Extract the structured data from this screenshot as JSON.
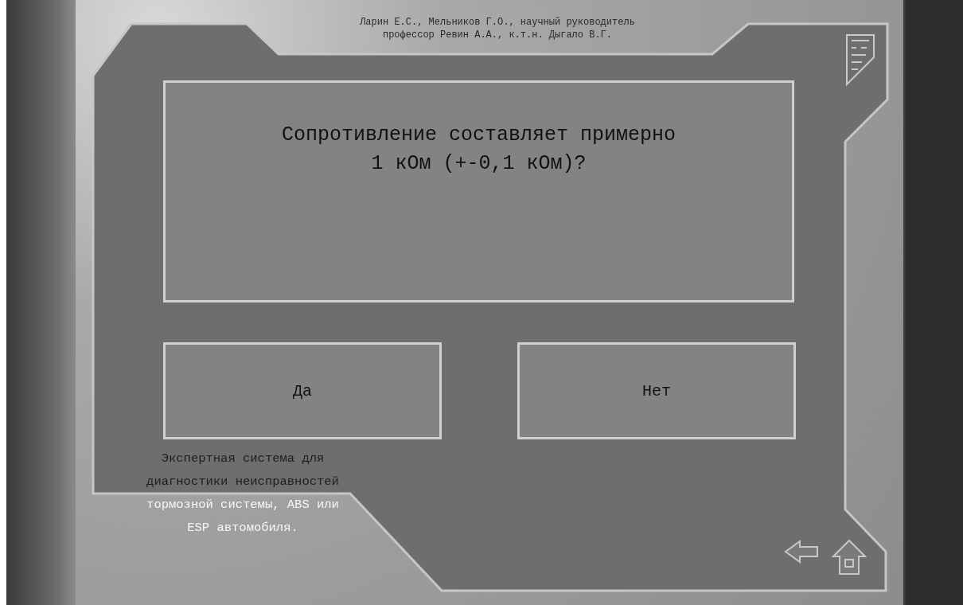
{
  "header": {
    "lines": [
      "Ларин Е.С., Мельников Г.О., научный руководитель",
      "профессор Ревин А.А., к.т.н. Дыгало В.Г."
    ]
  },
  "question": {
    "lines": [
      "Сопротивление составляет примерно",
      "1 кОм (+-0,1 кОм)?"
    ]
  },
  "answers": [
    {
      "label": "Да"
    },
    {
      "label": "Нет"
    }
  ],
  "footer": [
    {
      "text": "Экспертная система для",
      "kind": "dark"
    },
    {
      "text": "диагностики неисправностей",
      "kind": "dark"
    },
    {
      "text": "тормозной системы, ABS или",
      "kind": "light"
    },
    {
      "text": "ESP автомобиля.",
      "kind": "light"
    }
  ]
}
